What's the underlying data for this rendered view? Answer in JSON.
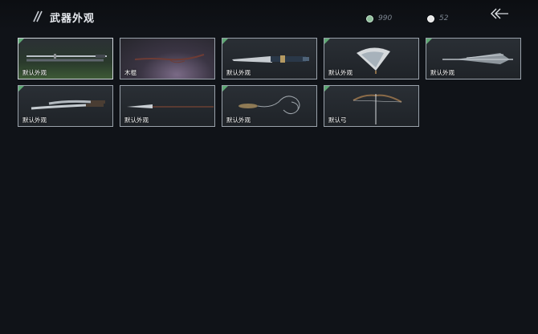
{
  "header": {
    "title": "武器外观",
    "currency": [
      {
        "name": "jade-coin",
        "value": "990",
        "color": "#8fbf9c"
      },
      {
        "name": "silver-coin",
        "value": "52",
        "color": "#e8e8e8"
      }
    ]
  },
  "weapons": [
    {
      "label": "默认外观",
      "icon": "sword-icon",
      "selected": true
    },
    {
      "label": "木棍",
      "icon": "staff-icon",
      "selected": false
    },
    {
      "label": "默认外观",
      "icon": "ornate-sword-icon",
      "selected": false
    },
    {
      "label": "默认外观",
      "icon": "fan-icon",
      "selected": false
    },
    {
      "label": "默认外观",
      "icon": "umbrella-icon",
      "selected": false
    },
    {
      "label": "默认外观",
      "icon": "dual-blades-icon",
      "selected": false
    },
    {
      "label": "默认外观",
      "icon": "spear-icon",
      "selected": false
    },
    {
      "label": "默认外观",
      "icon": "rope-dart-icon",
      "selected": false
    },
    {
      "label": "默认弓",
      "icon": "bow-icon",
      "selected": false
    }
  ]
}
